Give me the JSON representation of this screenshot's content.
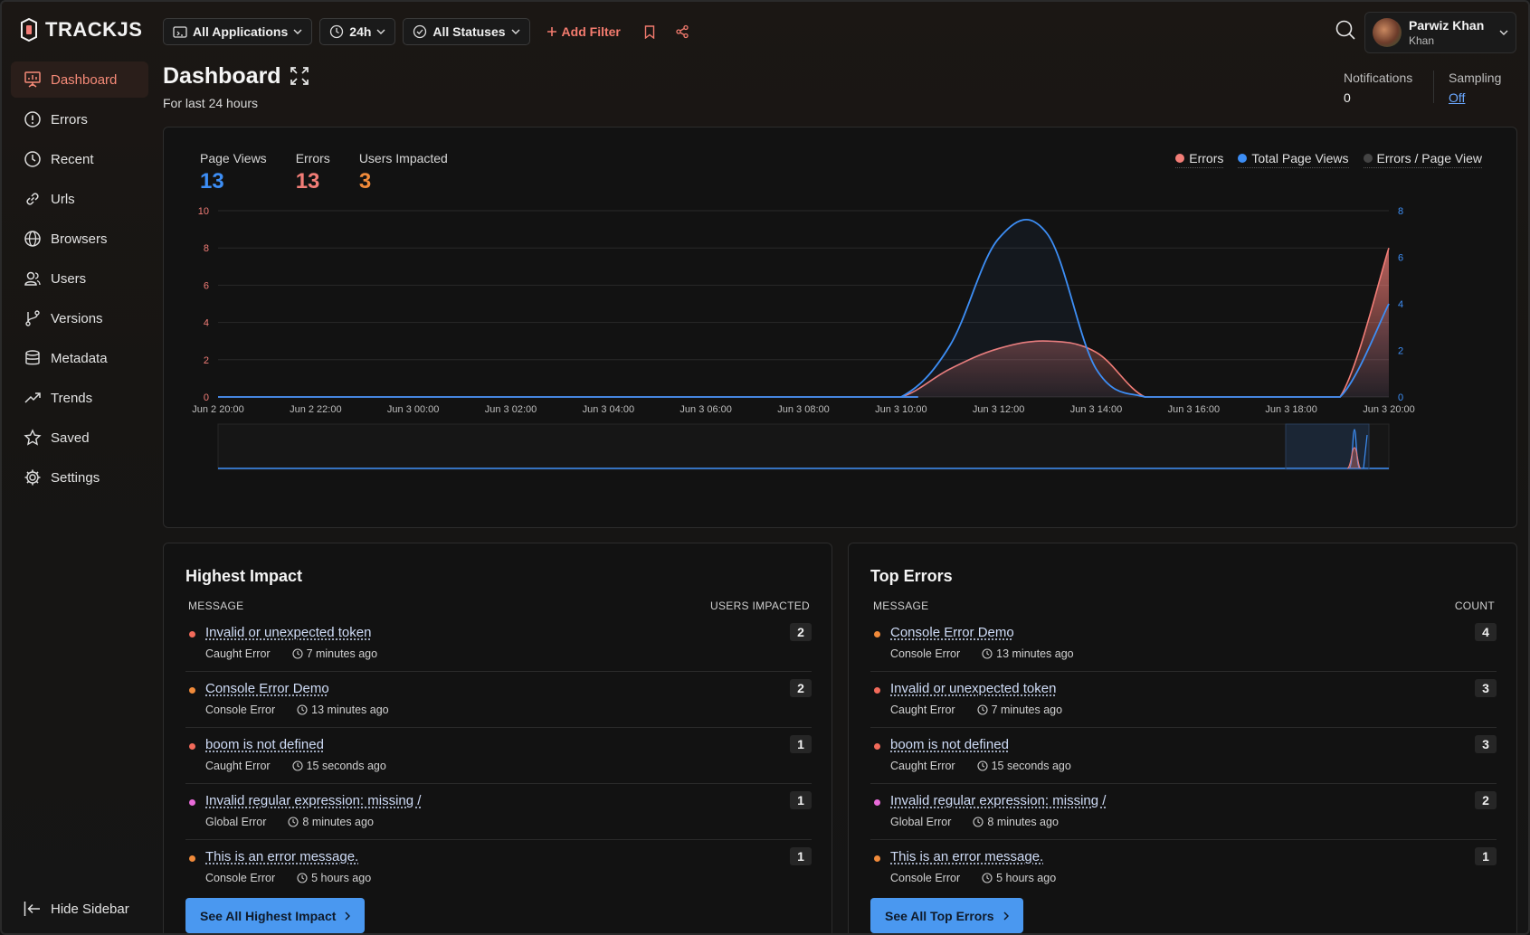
{
  "app": {
    "logo_text": "TRACKJS"
  },
  "topbar": {
    "applications": "All Applications",
    "timerange": "24h",
    "statuses": "All Statuses",
    "add_filter": "Add Filter"
  },
  "user": {
    "name": "Parwiz Khan",
    "sub": "Khan"
  },
  "sidebar": {
    "items": [
      {
        "label": "Dashboard",
        "icon": "dashboard-icon",
        "active": true
      },
      {
        "label": "Errors",
        "icon": "error-icon"
      },
      {
        "label": "Recent",
        "icon": "clock-icon"
      },
      {
        "label": "Urls",
        "icon": "link-icon"
      },
      {
        "label": "Browsers",
        "icon": "globe-icon"
      },
      {
        "label": "Users",
        "icon": "users-icon"
      },
      {
        "label": "Versions",
        "icon": "branch-icon"
      },
      {
        "label": "Metadata",
        "icon": "database-icon"
      },
      {
        "label": "Trends",
        "icon": "trend-icon"
      },
      {
        "label": "Saved",
        "icon": "star-icon"
      },
      {
        "label": "Settings",
        "icon": "gear-icon"
      }
    ],
    "hide_label": "Hide Sidebar"
  },
  "header": {
    "title": "Dashboard",
    "subtitle": "For last 24 hours",
    "notifications_label": "Notifications",
    "notifications_value": "0",
    "sampling_label": "Sampling",
    "sampling_value": "Off"
  },
  "metrics": {
    "page_views_label": "Page Views",
    "page_views": "13",
    "errors_label": "Errors",
    "errors": "13",
    "users_label": "Users Impacted",
    "users": "3"
  },
  "colors": {
    "errors": "#f27d77",
    "page_views": "#3d8ef5",
    "users": "#f08a3a",
    "ratio": "#444444"
  },
  "chart_data": {
    "type": "area",
    "legend": [
      "Errors",
      "Total Page Views",
      "Errors / Page View"
    ],
    "legend_position": "top-right",
    "x_ticks": [
      "Jun 2 20:00",
      "Jun 2 22:00",
      "Jun 3 00:00",
      "Jun 3 02:00",
      "Jun 3 04:00",
      "Jun 3 06:00",
      "Jun 3 08:00",
      "Jun 3 10:00",
      "Jun 3 12:00",
      "Jun 3 14:00",
      "Jun 3 16:00",
      "Jun 3 18:00",
      "Jun 3 20:00"
    ],
    "y_left_ticks": [
      "0",
      "2",
      "4",
      "6",
      "8",
      "10"
    ],
    "y_right_ticks": [
      "0",
      "2",
      "4",
      "6",
      "8"
    ],
    "ylim_left": [
      0,
      10
    ],
    "ylim_right": [
      0,
      8
    ],
    "grid": true,
    "x_hours": [
      0,
      13,
      14,
      15,
      16,
      17,
      18,
      19,
      20,
      21,
      22,
      23,
      24
    ],
    "series": [
      {
        "name": "Errors",
        "axis": "left",
        "values": [
          0,
          0,
          0,
          1.5,
          2.6,
          3,
          2.4,
          0,
          0,
          0,
          0,
          0,
          8
        ]
      },
      {
        "name": "Total Page Views",
        "axis": "right",
        "values": [
          0,
          0,
          0,
          2.2,
          6.8,
          7,
          1.2,
          0,
          0,
          0,
          0,
          0,
          4
        ]
      }
    ]
  },
  "highest_impact": {
    "title": "Highest Impact",
    "col_message": "MESSAGE",
    "col_value": "USERS IMPACTED",
    "button": "See All Highest Impact",
    "rows": [
      {
        "msg": "Invalid or unexpected token",
        "type": "Caught Error",
        "time": "7 minutes ago",
        "count": "2",
        "color": "#f26a5a"
      },
      {
        "msg": "Console Error Demo",
        "type": "Console Error",
        "time": "13 minutes ago",
        "count": "2",
        "color": "#f08a3a"
      },
      {
        "msg": "boom is not defined",
        "type": "Caught Error",
        "time": "15 seconds ago",
        "count": "1",
        "color": "#f26a5a"
      },
      {
        "msg": "Invalid regular expression: missing /",
        "type": "Global Error",
        "time": "8 minutes ago",
        "count": "1",
        "color": "#e86ad8"
      },
      {
        "msg": "This is an error message.",
        "type": "Console Error",
        "time": "5 hours ago",
        "count": "1",
        "color": "#f08a3a"
      }
    ]
  },
  "top_errors": {
    "title": "Top Errors",
    "col_message": "MESSAGE",
    "col_value": "COUNT",
    "button": "See All Top Errors",
    "rows": [
      {
        "msg": "Console Error Demo",
        "type": "Console Error",
        "time": "13 minutes ago",
        "count": "4",
        "color": "#f08a3a"
      },
      {
        "msg": "Invalid or unexpected token",
        "type": "Caught Error",
        "time": "7 minutes ago",
        "count": "3",
        "color": "#f26a5a"
      },
      {
        "msg": "boom is not defined",
        "type": "Caught Error",
        "time": "15 seconds ago",
        "count": "3",
        "color": "#f26a5a"
      },
      {
        "msg": "Invalid regular expression: missing /",
        "type": "Global Error",
        "time": "8 minutes ago",
        "count": "2",
        "color": "#e86ad8"
      },
      {
        "msg": "This is an error message.",
        "type": "Console Error",
        "time": "5 hours ago",
        "count": "1",
        "color": "#f08a3a"
      }
    ]
  }
}
